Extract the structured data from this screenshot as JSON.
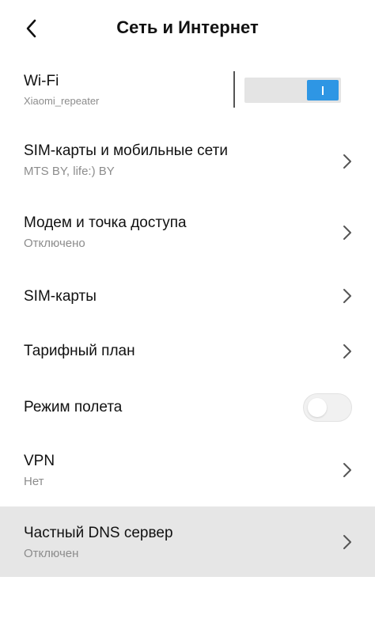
{
  "header": {
    "title": "Сеть и Интернет",
    "back_icon": "chevron-left-icon"
  },
  "wifi": {
    "title": "Wi-Fi",
    "subtitle": "Xiaomi_repeater",
    "enabled": true,
    "accent_color": "#2e96e4"
  },
  "items": [
    {
      "title": "SIM-карты и мобильные сети",
      "subtitle": "MTS BY, life:) BY"
    },
    {
      "title": "Модем и точка доступа",
      "subtitle": "Отключено"
    },
    {
      "title": "SIM-карты"
    },
    {
      "title": "Тарифный план"
    },
    {
      "title": "Режим полета",
      "enabled": false
    },
    {
      "title": "VPN",
      "subtitle": "Нет"
    },
    {
      "title": "Частный DNS сервер",
      "subtitle": "Отключен"
    }
  ],
  "colors": {
    "highlight_row": "#e6e6e6",
    "subtitle": "#8c8c8c"
  }
}
